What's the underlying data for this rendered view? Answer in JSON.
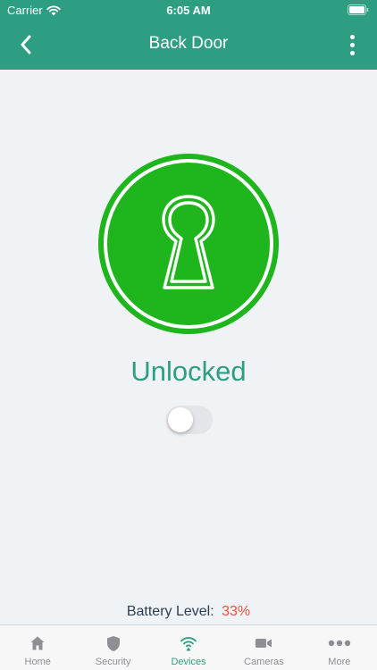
{
  "status_bar": {
    "carrier": "Carrier",
    "time": "6:05 AM"
  },
  "nav": {
    "title": "Back Door"
  },
  "lock": {
    "status": "Unlocked",
    "locked": false,
    "color": "#1fb51d"
  },
  "battery": {
    "label": "Battery Level:",
    "value": "33%",
    "value_color": "#e8513a"
  },
  "tabs": [
    {
      "label": "Home",
      "icon": "home-icon",
      "active": false
    },
    {
      "label": "Security",
      "icon": "shield-icon",
      "active": false
    },
    {
      "label": "Devices",
      "icon": "wifi-icon",
      "active": true
    },
    {
      "label": "Cameras",
      "icon": "video-camera-icon",
      "active": false
    },
    {
      "label": "More",
      "icon": "ellipsis-icon",
      "active": false
    }
  ],
  "colors": {
    "accent": "#2e9e82",
    "background": "#f0f3f6"
  }
}
